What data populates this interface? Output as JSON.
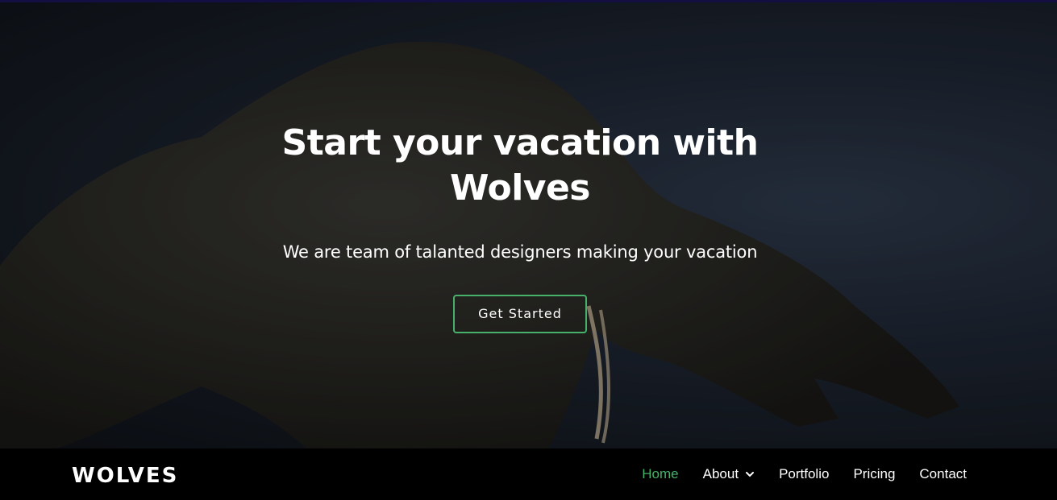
{
  "hero": {
    "title_line1": "Start your vacation with",
    "title_line2": "Wolves",
    "subtitle": "We are team of talanted designers making your vacation",
    "cta_label": "Get Started"
  },
  "navbar": {
    "logo": "WOLVES",
    "items": [
      {
        "label": "Home",
        "active": true
      },
      {
        "label": "About",
        "icon": "chevron-down-icon"
      },
      {
        "label": "Portfolio"
      },
      {
        "label": "Pricing"
      },
      {
        "label": "Contact"
      }
    ]
  },
  "colors": {
    "accent": "#47b06a",
    "navbar_bg": "#000000",
    "text": "#ffffff"
  }
}
